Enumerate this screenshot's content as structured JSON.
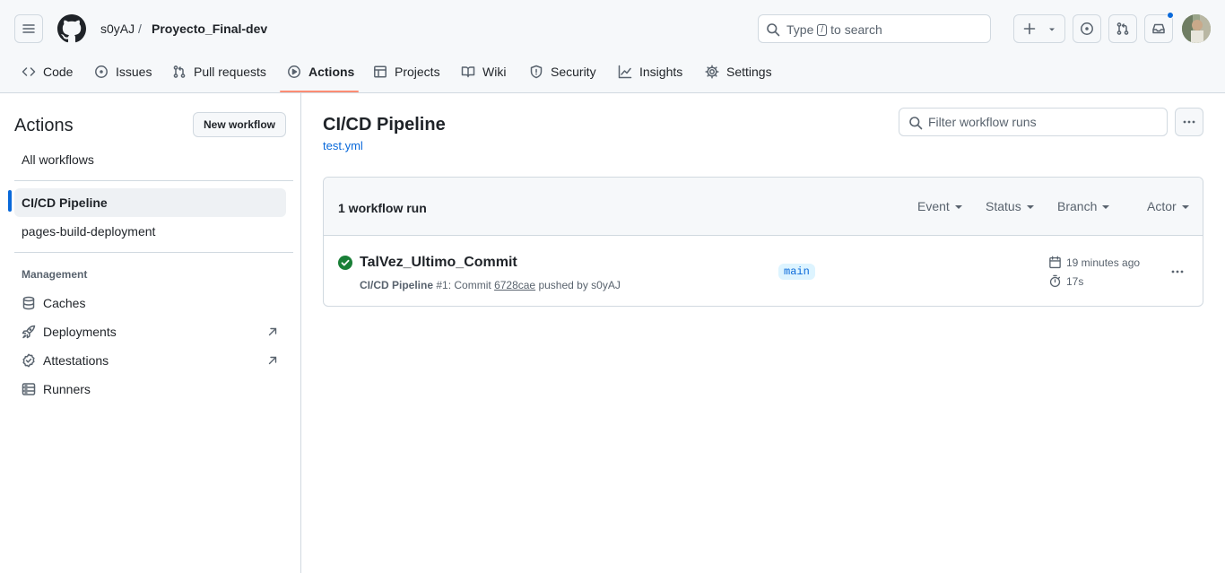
{
  "header": {
    "owner": "s0yAJ",
    "separator": "/",
    "repo": "Proyecto_Final-dev",
    "search": {
      "prefix": "Type",
      "key": "/",
      "suffix": "to search"
    }
  },
  "tabs": [
    {
      "label": "Code",
      "icon": "code-icon"
    },
    {
      "label": "Issues",
      "icon": "issue-opened-icon"
    },
    {
      "label": "Pull requests",
      "icon": "git-pull-request-icon"
    },
    {
      "label": "Actions",
      "icon": "play-icon",
      "active": true
    },
    {
      "label": "Projects",
      "icon": "table-icon"
    },
    {
      "label": "Wiki",
      "icon": "book-icon"
    },
    {
      "label": "Security",
      "icon": "shield-icon"
    },
    {
      "label": "Insights",
      "icon": "graph-icon"
    },
    {
      "label": "Settings",
      "icon": "gear-icon"
    }
  ],
  "sidebar": {
    "title": "Actions",
    "new_workflow": "New workflow",
    "all_workflows": "All workflows",
    "workflows": [
      {
        "label": "CI/CD Pipeline",
        "selected": true
      },
      {
        "label": "pages-build-deployment"
      }
    ],
    "management_title": "Management",
    "management": [
      {
        "label": "Caches",
        "icon": "database-icon"
      },
      {
        "label": "Deployments",
        "icon": "rocket-icon",
        "external": true
      },
      {
        "label": "Attestations",
        "icon": "verified-icon",
        "external": true
      },
      {
        "label": "Runners",
        "icon": "server-icon"
      }
    ]
  },
  "main": {
    "title": "CI/CD Pipeline",
    "file": "test.yml",
    "filter_placeholder": "Filter workflow runs",
    "runs_count": "1 workflow run",
    "filters": [
      "Event",
      "Status",
      "Branch",
      "Actor"
    ],
    "runs": [
      {
        "title": "TalVez_Ultimo_Commit",
        "workflow": "CI/CD Pipeline",
        "meta_pre": "#1: Commit",
        "sha": "6728cae",
        "meta_post": "pushed by s0yAJ",
        "branch": "main",
        "time": "19 minutes ago",
        "duration": "17s",
        "status": "success"
      }
    ]
  },
  "colors": {
    "accent": "#0969da",
    "success": "#1a7f37",
    "tab_underline": "#fd8c73",
    "notification": "#0969da"
  }
}
